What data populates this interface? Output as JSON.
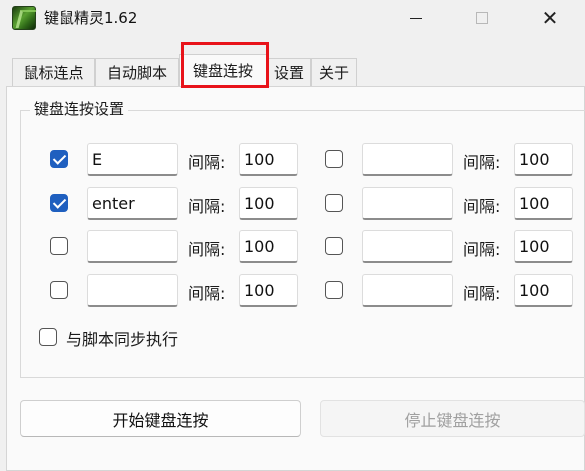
{
  "window": {
    "title": "键鼠精灵1.62",
    "minimize_icon": "minimize-icon",
    "maximize_icon": "maximize-icon",
    "close_icon": "close-icon",
    "close_glyph": "✕"
  },
  "tabs": [
    {
      "label": "鼠标连点",
      "active": false
    },
    {
      "label": "自动脚本",
      "active": false
    },
    {
      "label": "键盘连按",
      "active": true
    },
    {
      "label": "设置",
      "active": false
    },
    {
      "label": "关于",
      "active": false
    }
  ],
  "highlight_color": "#e8131a",
  "group": {
    "title": "键盘连按设置",
    "interval_label": "间隔:",
    "rows": [
      {
        "left": {
          "checked": true,
          "key": "E",
          "interval": "100"
        },
        "right": {
          "checked": false,
          "key": "",
          "interval": "100"
        }
      },
      {
        "left": {
          "checked": true,
          "key": "enter",
          "interval": "100"
        },
        "right": {
          "checked": false,
          "key": "",
          "interval": "100"
        }
      },
      {
        "left": {
          "checked": false,
          "key": "",
          "interval": "100"
        },
        "right": {
          "checked": false,
          "key": "",
          "interval": "100"
        }
      },
      {
        "left": {
          "checked": false,
          "key": "",
          "interval": "100"
        },
        "right": {
          "checked": false,
          "key": "",
          "interval": "100"
        }
      }
    ],
    "sync_label": "与脚本同步执行",
    "sync_checked": false
  },
  "buttons": {
    "start": "开始键盘连按",
    "stop": "停止键盘连按",
    "stop_enabled": false
  },
  "colors": {
    "check_blue": "#1f5fbf"
  }
}
